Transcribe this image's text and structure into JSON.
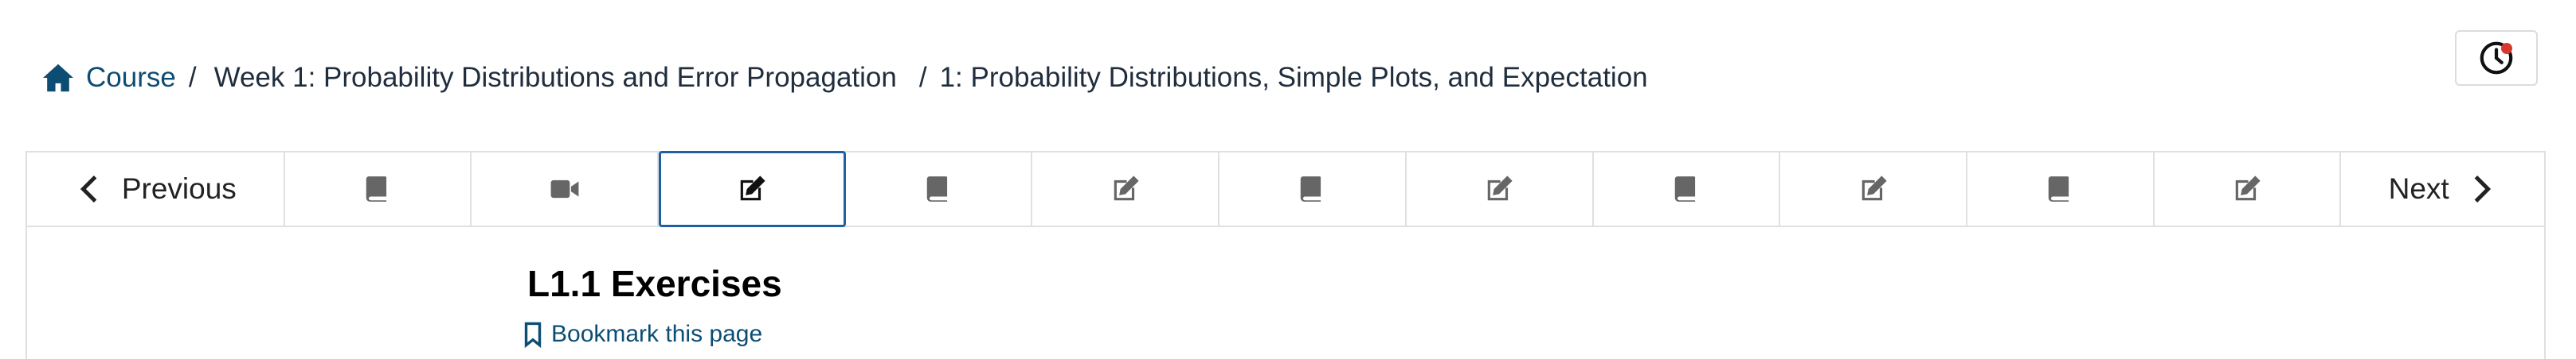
{
  "breadcrumb": {
    "home_label": "Course",
    "section_label": "Week 1: Probability Distributions and Error Propagation",
    "subsection_label": "1: Probability Distributions, Simple Plots, and Expectation"
  },
  "nav": {
    "previous_label": "Previous",
    "next_label": "Next",
    "units": [
      {
        "icon": "book-icon"
      },
      {
        "icon": "video-icon"
      },
      {
        "icon": "edit-icon",
        "active": true
      },
      {
        "icon": "book-icon"
      },
      {
        "icon": "edit-icon"
      },
      {
        "icon": "book-icon"
      },
      {
        "icon": "edit-icon"
      },
      {
        "icon": "book-icon"
      },
      {
        "icon": "edit-icon"
      },
      {
        "icon": "book-icon"
      },
      {
        "icon": "edit-icon"
      }
    ]
  },
  "unit": {
    "title": "L1.1 Exercises",
    "bookmark_label": "Bookmark this page"
  },
  "colors": {
    "link": "#0d4d73",
    "active_border": "#1f5fa3",
    "notification_dot": "#d9382f"
  }
}
